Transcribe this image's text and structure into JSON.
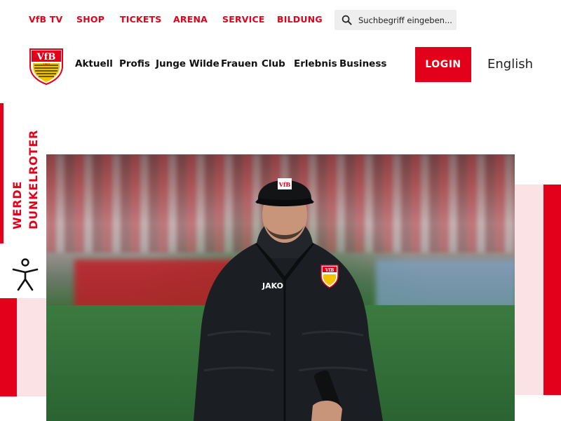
{
  "topnav": {
    "items": [
      {
        "key": "vfbtv",
        "label": "VfB TV"
      },
      {
        "key": "shop",
        "label": "SHOP"
      },
      {
        "key": "tickets",
        "label": "TICKETS"
      },
      {
        "key": "arena",
        "label": "ARENA"
      },
      {
        "key": "service",
        "label": "SERVICE"
      },
      {
        "key": "bildung",
        "label": "BILDUNG"
      }
    ]
  },
  "search": {
    "placeholder": "Suchbegriff eingeben...",
    "value": ""
  },
  "logo": {
    "text": "VfB",
    "year": "1893"
  },
  "mainnav": {
    "items": [
      {
        "key": "aktuell",
        "label": "Aktuell"
      },
      {
        "key": "profis",
        "label": "Profis"
      },
      {
        "key": "junge-wilde",
        "label": "Junge Wilde"
      },
      {
        "key": "frauen",
        "label": "Frauen"
      },
      {
        "key": "club",
        "label": "Club"
      },
      {
        "key": "erlebnis",
        "label": "Erlebnis"
      },
      {
        "key": "business",
        "label": "Business"
      }
    ]
  },
  "login": {
    "label": "LOGIN"
  },
  "language": {
    "label": "English"
  },
  "cta": {
    "line1": "WERDE",
    "line2": "DUNKELROTER"
  },
  "hero": {
    "jacket_brand": "JAKO",
    "cap_text": "VfB",
    "badge_text": "VfB"
  },
  "colors": {
    "brand_red": "#e3001b",
    "pink": "#fbe3e5",
    "dark_text": "#111111"
  },
  "icons": {
    "search": "search-icon",
    "accessibility": "accessibility-icon",
    "crest": "vfb-crest-icon"
  }
}
